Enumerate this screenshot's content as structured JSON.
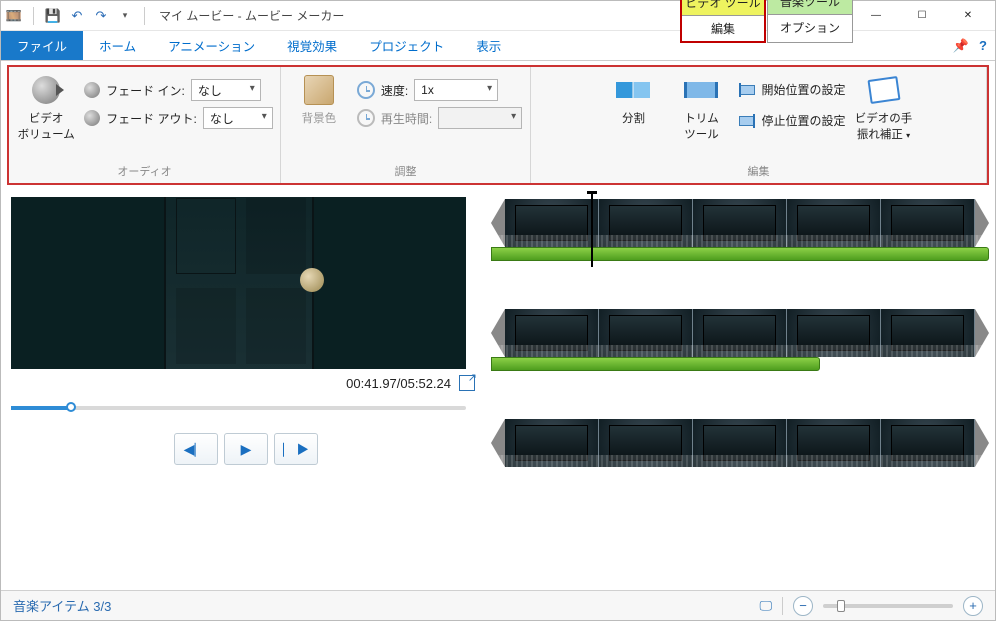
{
  "title": "マイ ムービー - ムービー メーカー",
  "tool_tabs": {
    "video": {
      "top": "ビデオ ツール",
      "bot": "編集"
    },
    "audio": {
      "top": "音楽ツール",
      "bot": "オプション"
    }
  },
  "tabs": {
    "file": "ファイル",
    "home": "ホーム",
    "anim": "アニメーション",
    "vfx": "視覚効果",
    "project": "プロジェクト",
    "view": "表示"
  },
  "ribbon": {
    "audio": {
      "volume": "ビデオ\nボリューム",
      "fadein_lbl": "フェード イン:",
      "fadeout_lbl": "フェード アウト:",
      "fadein_val": "なし",
      "fadeout_val": "なし",
      "group": "オーディオ"
    },
    "adjust": {
      "bgcolor": "背景色",
      "speed_lbl": "速度:",
      "speed_val": "1x",
      "duration_lbl": "再生時間:",
      "duration_val": "",
      "group": "調整"
    },
    "edit": {
      "split": "分割",
      "trim": "トリム\nツール",
      "start": "開始位置の設定",
      "stop": "停止位置の設定",
      "stabilize": "ビデオの手\n振れ補正",
      "group": "編集"
    }
  },
  "preview": {
    "time": "00:41.97/05:52.24"
  },
  "status": {
    "text": "音楽アイテム 3/3"
  }
}
